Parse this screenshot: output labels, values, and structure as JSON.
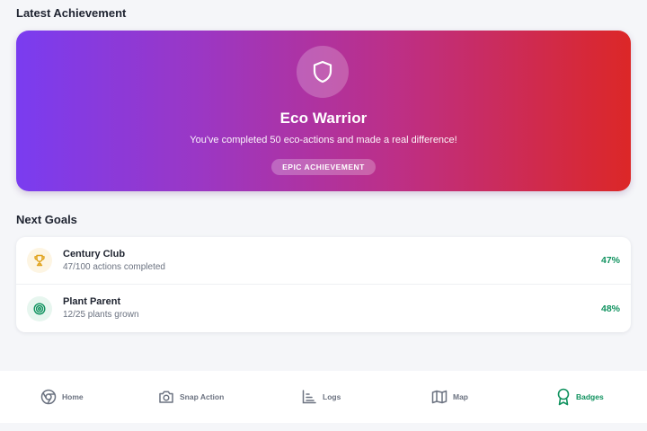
{
  "sections": {
    "latest_title": "Latest Achievement",
    "next_title": "Next Goals"
  },
  "achievement": {
    "icon": "shield-icon",
    "title": "Eco Warrior",
    "description": "You've completed 50 eco-actions and made a real difference!",
    "badge": "EPIC ACHIEVEMENT",
    "gradient_colors": [
      "#7a3cf0",
      "#dc2727"
    ]
  },
  "goals": [
    {
      "icon": "trophy-icon",
      "name": "Century Club",
      "progress_text": "47/100 actions completed",
      "percent": "47%"
    },
    {
      "icon": "target-icon",
      "name": "Plant Parent",
      "progress_text": "12/25 plants grown",
      "percent": "48%"
    }
  ],
  "nav": {
    "items": [
      {
        "icon": "home-icon",
        "label": "Home",
        "active": false
      },
      {
        "icon": "camera-icon",
        "label": "Snap Action",
        "active": false
      },
      {
        "icon": "logs-icon",
        "label": "Logs",
        "active": false
      },
      {
        "icon": "map-icon",
        "label": "Map",
        "active": false
      },
      {
        "icon": "badge-icon",
        "label": "Badges",
        "active": true
      }
    ]
  },
  "colors": {
    "accent_green": "#10925f",
    "muted_text": "#6b7280"
  }
}
